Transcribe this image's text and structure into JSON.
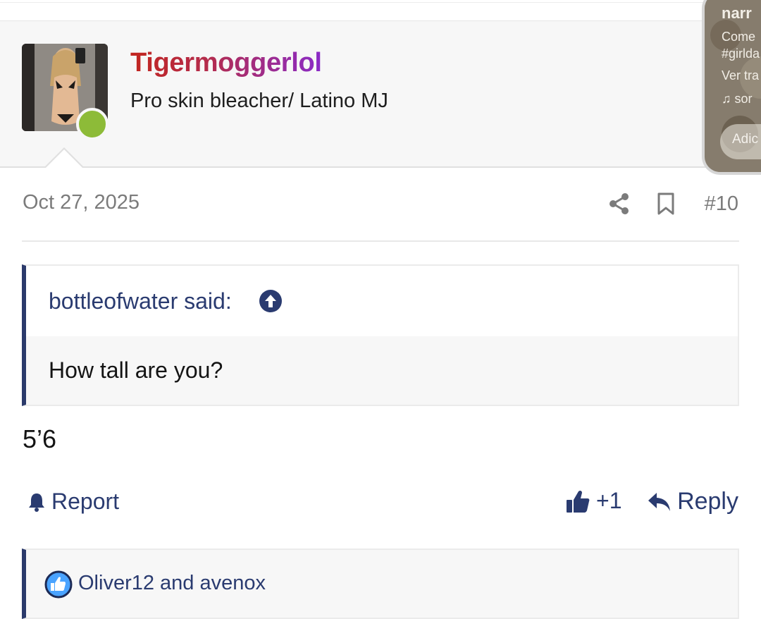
{
  "user": {
    "username": "Tigermoggerlol",
    "title": "Pro skin bleacher/ Latino MJ",
    "online": true
  },
  "overlay_card": {
    "title": "narr",
    "line1": "Come",
    "line2": "#girlda",
    "line3": "Ver tra",
    "song": "sor",
    "button": "Adic"
  },
  "post": {
    "date": "Oct 27, 2025",
    "number": "#10",
    "quote": {
      "author_label": "bottleofwater said:",
      "text": "How tall are you?"
    },
    "message": "5’6"
  },
  "actions": {
    "report": "Report",
    "reaction_count": "+1",
    "reply": "Reply"
  },
  "reactions": {
    "users": "Oliver12 and avenox"
  },
  "colors": {
    "link": "#2a3b70",
    "online": "#8dbb38",
    "username_gradient": [
      "#c2261f",
      "#8a2bc8"
    ]
  }
}
